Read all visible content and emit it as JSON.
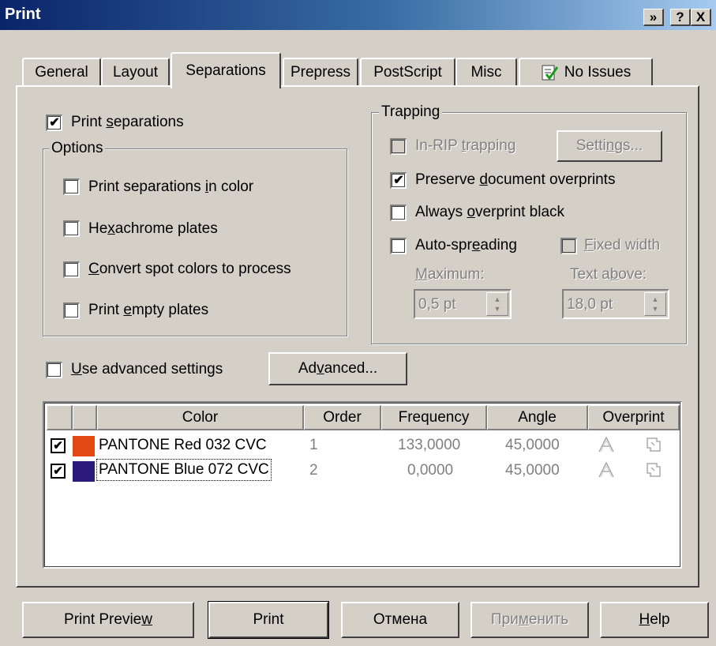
{
  "window": {
    "title": "Print"
  },
  "titlebar_buttons": {
    "help_glyph": "?",
    "close_glyph": "X",
    "extra_glyph": "»"
  },
  "tabs": [
    {
      "label": "General"
    },
    {
      "label": "Layout"
    },
    {
      "label": "Separations",
      "active": true
    },
    {
      "label": "Prepress"
    },
    {
      "label": "PostScript"
    },
    {
      "label": "Misc"
    },
    {
      "label": "No Issues",
      "icon": "check-document-icon"
    }
  ],
  "separations": {
    "print_separations": {
      "label_pre": "Print ",
      "label_ul": "s",
      "label_post": "eparations",
      "checked": true
    }
  },
  "options": {
    "legend": "Options",
    "items": [
      {
        "pre": "Print separations ",
        "ul": "i",
        "post": "n color",
        "checked": false
      },
      {
        "pre": "He",
        "ul": "x",
        "post": "achrome plates",
        "checked": false
      },
      {
        "pre": "",
        "ul": "C",
        "post": "onvert spot colors to process",
        "checked": false
      },
      {
        "pre": "Print ",
        "ul": "e",
        "post": "mpty plates",
        "checked": false
      }
    ]
  },
  "trapping": {
    "legend": "Trapping",
    "in_rip": {
      "pre": "In-RIP ",
      "ul": "t",
      "post": "rapping",
      "checked": false,
      "disabled": true
    },
    "settings_button": {
      "pre": "Setti",
      "ul": "n",
      "post": "gs..."
    },
    "preserve": {
      "pre": "Preserve ",
      "ul": "d",
      "post": "ocument overprints",
      "checked": true
    },
    "always_overprint": {
      "pre": "Always ",
      "ul": "o",
      "post": "verprint black",
      "checked": false
    },
    "auto_spreading": {
      "pre": "Auto-spr",
      "ul": "e",
      "post": "ading",
      "checked": false
    },
    "fixed_width": {
      "pre": "",
      "ul": "F",
      "post": "ixed width",
      "checked": false,
      "disabled": true
    },
    "maximum": {
      "pre": "",
      "ul": "M",
      "post": "aximum:",
      "value": "0,5 pt"
    },
    "text_above": {
      "pre": "Text a",
      "ul": "b",
      "post": "ove:",
      "value": "18,0 pt"
    }
  },
  "advanced": {
    "use_advanced": {
      "pre": "",
      "ul": "U",
      "post": "se advanced settings",
      "checked": false
    },
    "button": {
      "pre": "Ad",
      "ul": "v",
      "post": "anced..."
    }
  },
  "plates_table": {
    "headers": [
      "Color",
      "Order",
      "Frequency",
      "Angle",
      "Overprint"
    ],
    "rows": [
      {
        "checked": true,
        "swatch": "#e34a13",
        "color": "PANTONE Red 032 CVC",
        "order": "1",
        "frequency": "133,0000",
        "angle": "45,0000"
      },
      {
        "checked": true,
        "swatch": "#2b1a7a",
        "color": "PANTONE Blue 072 CVC",
        "order": "2",
        "frequency": "0,0000",
        "angle": "45,0000"
      }
    ]
  },
  "footer": {
    "print_preview": {
      "pre": "Print Previe",
      "ul": "w",
      "post": ""
    },
    "print": "Print",
    "cancel": "Отмена",
    "apply": {
      "pre": "При",
      "ul": "м",
      "post": "енить"
    },
    "help": {
      "pre": "",
      "ul": "H",
      "post": "elp"
    }
  }
}
